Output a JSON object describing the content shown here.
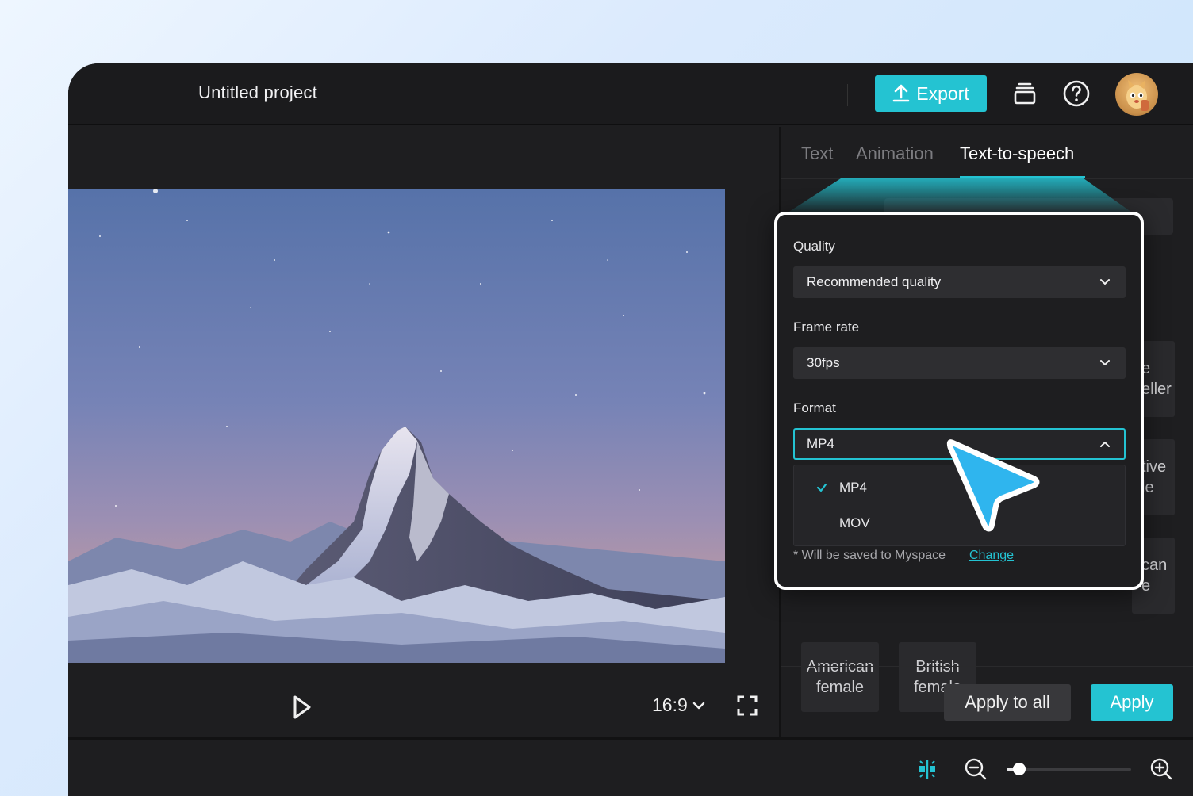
{
  "header": {
    "project_title": "Untitled project",
    "export_label": "Export",
    "accent_color": "#24c3d2"
  },
  "preview": {
    "aspect_ratio": "16:9"
  },
  "tabs": [
    {
      "label": "Text",
      "active": false
    },
    {
      "label": "Animation",
      "active": false
    },
    {
      "label": "Text-to-speech",
      "active": true
    }
  ],
  "background_cards": {
    "card_1": "e\neller",
    "card_2": "tive\nle",
    "card_3": "can\ne"
  },
  "voices": [
    {
      "line1": "American",
      "line2": "female"
    },
    {
      "line1": "British",
      "line2": "female"
    }
  ],
  "actions": {
    "apply_all_label": "Apply to all",
    "apply_label": "Apply"
  },
  "export_dialog": {
    "quality_label": "Quality",
    "quality_value": "Recommended quality",
    "frame_rate_label": "Frame rate",
    "frame_rate_value": "30fps",
    "format_label": "Format",
    "format_value": "MP4",
    "format_options": [
      {
        "label": "MP4",
        "selected": true
      },
      {
        "label": "MOV",
        "selected": false
      }
    ],
    "save_note": "* Will be saved to Myspace",
    "change_label": "Change"
  },
  "timeline": {
    "zoom_level_fraction": 0.1
  },
  "icons": [
    "upload-icon",
    "layers-icon",
    "help-icon",
    "play-icon",
    "chevron-down-icon",
    "fullscreen-icon",
    "snap-icon",
    "zoom-out-icon",
    "zoom-in-icon",
    "check-icon",
    "chevron-up-icon",
    "pointer-cursor-icon"
  ]
}
